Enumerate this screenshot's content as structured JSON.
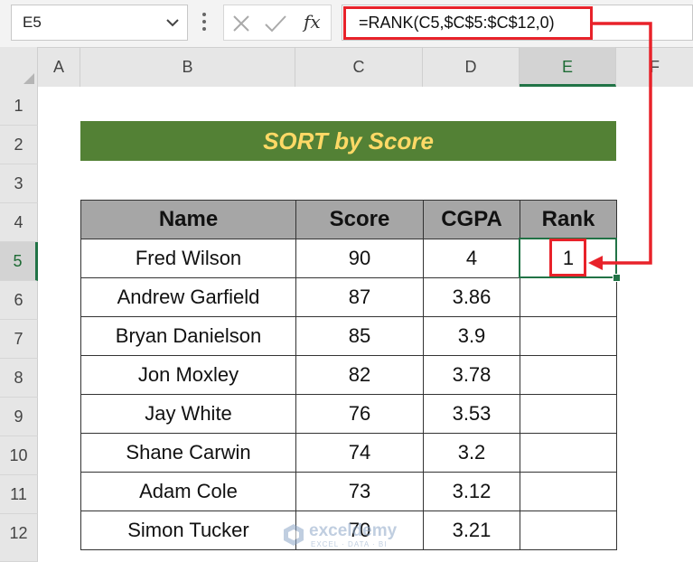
{
  "formula_bar": {
    "name_box": "E5",
    "fx_label": "fx",
    "formula": "=RANK(C5,$C$5:$C$12,0)"
  },
  "columns": [
    "A",
    "B",
    "C",
    "D",
    "E",
    "F"
  ],
  "rows": [
    "1",
    "2",
    "3",
    "4",
    "5",
    "6",
    "7",
    "8",
    "9",
    "10",
    "11",
    "12"
  ],
  "selected": {
    "column": "E",
    "row": "5"
  },
  "title": "SORT by Score",
  "table": {
    "headers": [
      "Name",
      "Score",
      "CGPA",
      "Rank"
    ],
    "rows": [
      [
        "Fred Wilson",
        "90",
        "4",
        "1"
      ],
      [
        "Andrew Garfield",
        "87",
        "3.86",
        ""
      ],
      [
        "Bryan Danielson",
        "85",
        "3.9",
        ""
      ],
      [
        "Jon Moxley",
        "82",
        "3.78",
        ""
      ],
      [
        "Jay White",
        "76",
        "3.53",
        ""
      ],
      [
        "Shane Carwin",
        "74",
        "3.2",
        ""
      ],
      [
        "Adam Cole",
        "73",
        "3.12",
        ""
      ],
      [
        "Simon Tucker",
        "70",
        "3.21",
        ""
      ]
    ]
  },
  "watermark": {
    "brand": "exceldemy",
    "tagline": "EXCEL · DATA · BI"
  },
  "colors": {
    "title_bg": "#538135",
    "title_text": "#ffd966",
    "header_bg": "#a6a6a6",
    "highlight": "#e8222a",
    "selection": "#217346"
  }
}
